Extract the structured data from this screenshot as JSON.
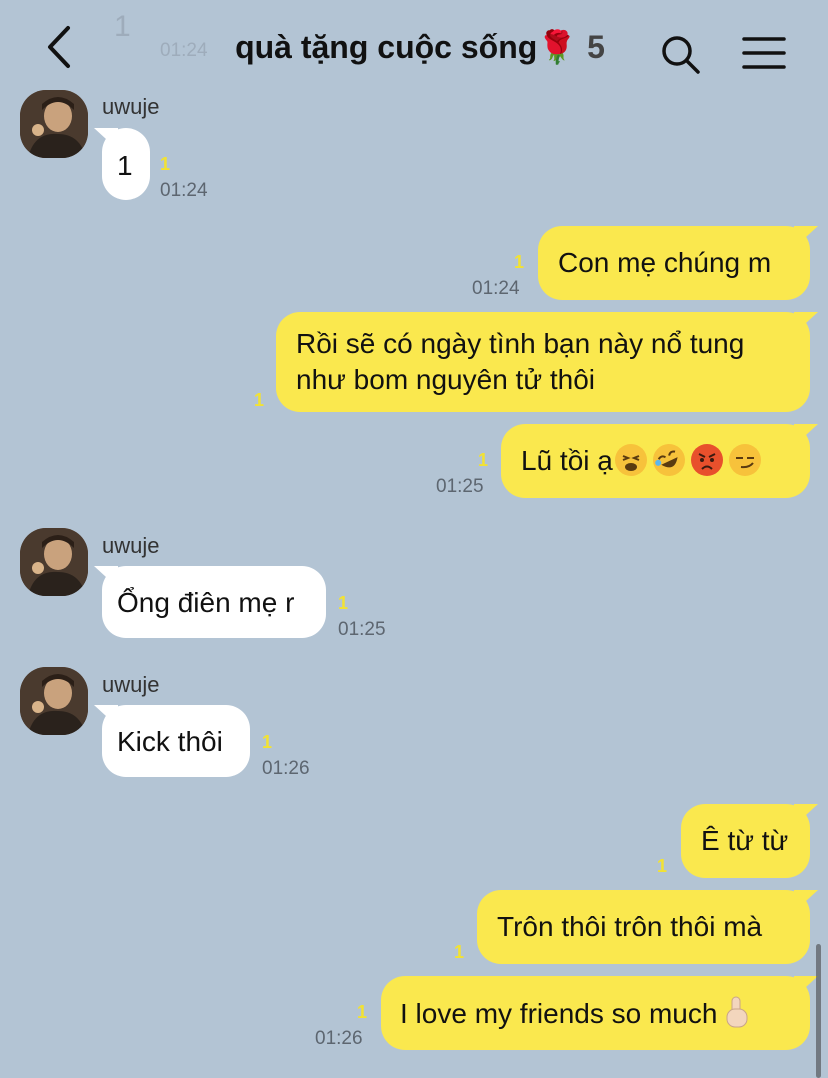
{
  "header": {
    "title": "quà tặng cuộc sống🌹",
    "member_count": "5",
    "ghost_text": "1",
    "ghost_time": "01:24"
  },
  "messages": [
    {
      "sender": "uwuje",
      "text": "1",
      "read": "1",
      "time": "01:24"
    },
    {
      "text": "Con mẹ chúng m",
      "read": "1",
      "time": "01:24"
    },
    {
      "text_line1": "Rồi sẽ có ngày tình bạn này nổ tung",
      "text_line2": "như bom nguyên tử thôi",
      "read": "1"
    },
    {
      "text": "Lũ tồi ạ",
      "read": "1",
      "time": "01:25",
      "emoji_icons": [
        "tired-face-icon",
        "rolling-laughing-icon",
        "angry-face-icon",
        "smirk-face-icon"
      ]
    },
    {
      "sender": "uwuje",
      "text": "Ổng điên mẹ r",
      "read": "1",
      "time": "01:25"
    },
    {
      "sender": "uwuje",
      "text": "Kick thôi",
      "read": "1",
      "time": "01:26"
    },
    {
      "text": "Ê từ từ",
      "read": "1"
    },
    {
      "text": "Trôn thôi trôn thôi mà",
      "read": "1"
    },
    {
      "text": "I love my friends so much",
      "read": "1",
      "time": "01:26",
      "emoji_icons": [
        "hand-pointing-up-icon"
      ]
    }
  ],
  "colors": {
    "background": "#b3c4d4",
    "outgoing_bubble": "#fae84e",
    "incoming_bubble": "#ffffff",
    "read_count": "#f2e233"
  }
}
